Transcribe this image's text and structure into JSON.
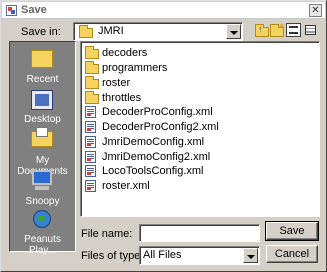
{
  "window": {
    "title": "Save"
  },
  "save_in": {
    "label": "Save in:",
    "value": "JMRI"
  },
  "toolbar": {
    "up_icon": "up-one-level-icon",
    "new_folder_icon": "new-folder-icon",
    "list_view_icon": "list-view-icon",
    "details_view_icon": "details-view-icon"
  },
  "places": [
    {
      "label": "Recent",
      "icon": "folder-icon"
    },
    {
      "label": "Desktop",
      "icon": "desktop-icon"
    },
    {
      "label": "My Documents",
      "icon": "documents-icon"
    },
    {
      "label": "Snoopy",
      "icon": "computer-icon"
    },
    {
      "label": "Peanuts Play...",
      "icon": "network-icon"
    }
  ],
  "files": [
    {
      "name": "decoders",
      "type": "folder"
    },
    {
      "name": "programmers",
      "type": "folder"
    },
    {
      "name": "roster",
      "type": "folder"
    },
    {
      "name": "throttles",
      "type": "folder"
    },
    {
      "name": "DecoderProConfig.xml",
      "type": "xml"
    },
    {
      "name": "DecoderProConfig2.xml",
      "type": "xml"
    },
    {
      "name": "JmriDemoConfig.xml",
      "type": "xml"
    },
    {
      "name": "JmriDemoConfig2.xml",
      "type": "xml"
    },
    {
      "name": "LocoToolsConfig.xml",
      "type": "xml"
    },
    {
      "name": "roster.xml",
      "type": "xml"
    }
  ],
  "file_name": {
    "label": "File name:",
    "value": ""
  },
  "file_type": {
    "label": "Files of type:",
    "value": "All Files"
  },
  "buttons": {
    "save": "Save",
    "cancel": "Cancel"
  },
  "colors": {
    "dialog_bg": "#d4d0c8",
    "places_bg": "#808080",
    "folder": "#f4d35e"
  }
}
